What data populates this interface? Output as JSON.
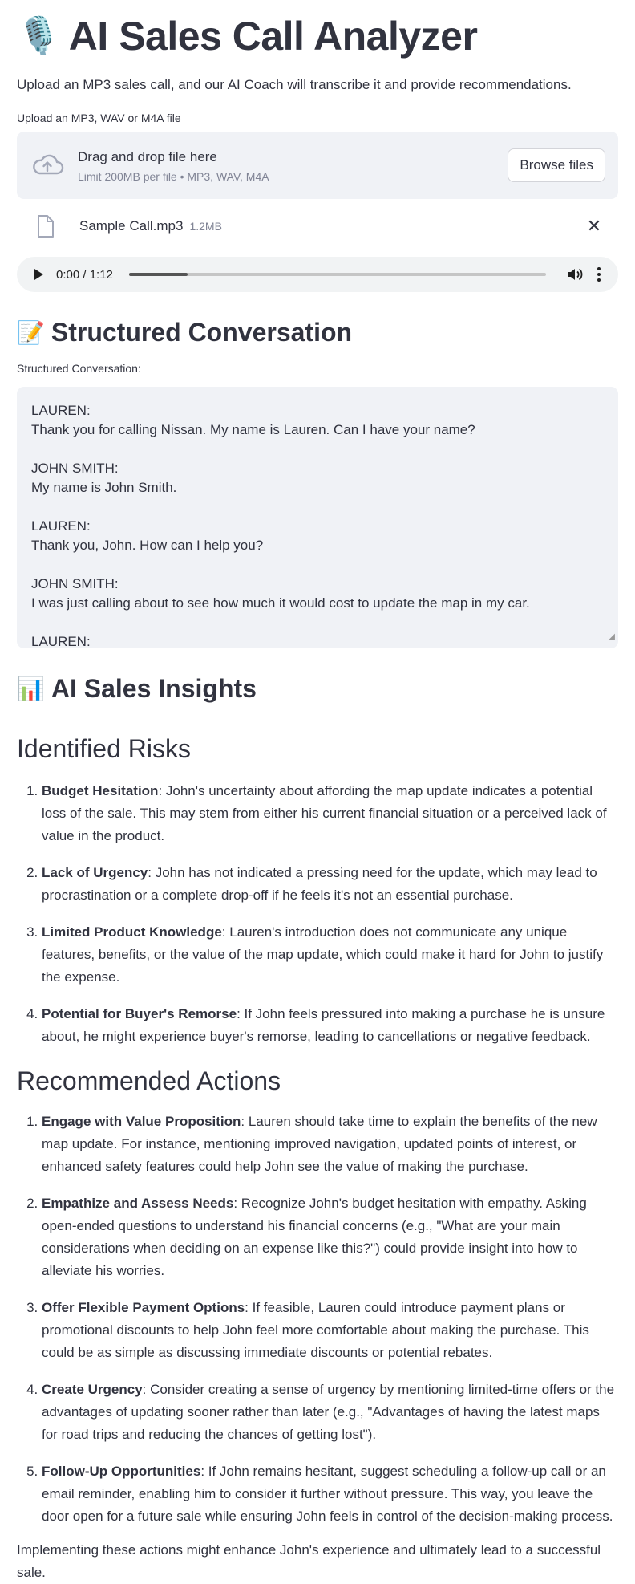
{
  "header": {
    "title_emoji": "🎙️",
    "title": "AI Sales Call Analyzer",
    "subtitle": "Upload an MP3 sales call, and our AI Coach will transcribe it and provide recommendations."
  },
  "uploader": {
    "label": "Upload an MP3, WAV or M4A file",
    "drop_text": "Drag and drop file here",
    "limit_text": "Limit 200MB per file • MP3, WAV, M4A",
    "browse_label": "Browse files",
    "icon": "cloud-upload-icon"
  },
  "file": {
    "name": "Sample Call.mp3",
    "size": "1.2MB",
    "remove_symbol": "✕"
  },
  "audio": {
    "time": "0:00 / 1:12",
    "buffered": 0.14
  },
  "conversation": {
    "heading_emoji": "📝",
    "heading": "Structured Conversation",
    "label": "Structured Conversation:",
    "entries": [
      {
        "speaker": "LAUREN:",
        "text": "Thank you for calling Nissan. My name is Lauren. Can I have your name?"
      },
      {
        "speaker": "JOHN SMITH:",
        "text": "My name is John Smith."
      },
      {
        "speaker": "LAUREN:",
        "text": "Thank you, John. How can I help you?"
      },
      {
        "speaker": "JOHN SMITH:",
        "text": "I was just calling about to see how much it would cost to update the map in my car."
      },
      {
        "speaker": "LAUREN:",
        "text": ""
      }
    ]
  },
  "insights": {
    "heading_emoji": "📊",
    "heading": "AI Sales Insights",
    "risks_heading": "Identified Risks",
    "risks": [
      {
        "title": "Budget Hesitation",
        "text": ": John's uncertainty about affording the map update indicates a potential loss of the sale. This may stem from either his current financial situation or a perceived lack of value in the product."
      },
      {
        "title": "Lack of Urgency",
        "text": ": John has not indicated a pressing need for the update, which may lead to procrastination or a complete drop-off if he feels it's not an essential purchase."
      },
      {
        "title": "Limited Product Knowledge",
        "text": ": Lauren's introduction does not communicate any unique features, benefits, or the value of the map update, which could make it hard for John to justify the expense."
      },
      {
        "title": "Potential for Buyer's Remorse",
        "text": ": If John feels pressured into making a purchase he is unsure about, he might experience buyer's remorse, leading to cancellations or negative feedback."
      }
    ],
    "actions_heading": "Recommended Actions",
    "actions": [
      {
        "title": "Engage with Value Proposition",
        "text": ": Lauren should take time to explain the benefits of the new map update. For instance, mentioning improved navigation, updated points of interest, or enhanced safety features could help John see the value of making the purchase."
      },
      {
        "title": "Empathize and Assess Needs",
        "text": ": Recognize John's budget hesitation with empathy. Asking open-ended questions to understand his financial concerns (e.g., \"What are your main considerations when deciding on an expense like this?\") could provide insight into how to alleviate his worries."
      },
      {
        "title": "Offer Flexible Payment Options",
        "text": ": If feasible, Lauren could introduce payment plans or promotional discounts to help John feel more comfortable about making the purchase. This could be as simple as discussing immediate discounts or potential rebates."
      },
      {
        "title": "Create Urgency",
        "text": ": Consider creating a sense of urgency by mentioning limited-time offers or the advantages of updating sooner rather than later (e.g., \"Advantages of having the latest maps for road trips and reducing the chances of getting lost\")."
      },
      {
        "title": "Follow-Up Opportunities",
        "text": ": If John remains hesitant, suggest scheduling a follow-up call or an email reminder, enabling him to consider it further without pressure. This way, you leave the door open for a future sale while ensuring John feels in control of the decision-making process."
      }
    ],
    "closing": "Implementing these actions might enhance John's experience and ultimately lead to a successful sale."
  }
}
